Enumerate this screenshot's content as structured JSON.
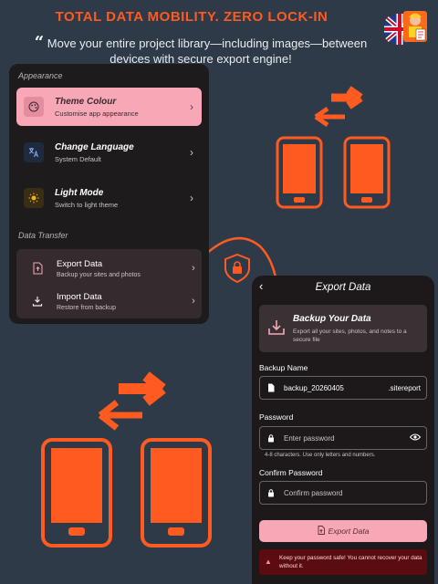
{
  "headline": "TOTAL DATA MOBILITY. ZERO LOCK-IN",
  "quote_mark": "“",
  "quote": "Move your entire project library—including images—between devices with secure export engine!",
  "settings": {
    "appearance_title": "Appearance",
    "items": [
      {
        "title": "Theme Colour",
        "subtitle": "Customise app appearance",
        "icon": "palette-icon"
      },
      {
        "title": "Change Language",
        "subtitle": "System Default",
        "icon": "translate-icon"
      },
      {
        "title": "Light Mode",
        "subtitle": "Switch to light theme",
        "icon": "sun-icon"
      }
    ],
    "data_transfer_title": "Data Transfer",
    "transfer_items": [
      {
        "title": "Export Data",
        "subtitle": "Backup your sites and photos",
        "icon": "export-file-icon"
      },
      {
        "title": "Import Data",
        "subtitle": "Restore from backup",
        "icon": "download-icon"
      }
    ],
    "chevron": "›"
  },
  "export_panel": {
    "back": "‹",
    "title": "Export Data",
    "backup_card_title": "Backup Your Data",
    "backup_card_desc": "Export all your sites, photos, and notes to a secure file",
    "backup_name_label": "Backup Name",
    "backup_name_value": "backup_20260405",
    "backup_name_suffix": ".sitereport",
    "password_label": "Password",
    "password_placeholder": "Enter password",
    "password_hint": "4-8 characters. Use only letters and numbers.",
    "confirm_label": "Confirm Password",
    "confirm_placeholder": "Confirm password",
    "export_button": "Export Data",
    "warning": "Keep your password safe! You cannot recover your data without it."
  },
  "colors": {
    "accent": "#ff5a1f",
    "pink": "#f8a7b7",
    "background": "#2f3a48",
    "warning_bg": "#5b0c10"
  }
}
